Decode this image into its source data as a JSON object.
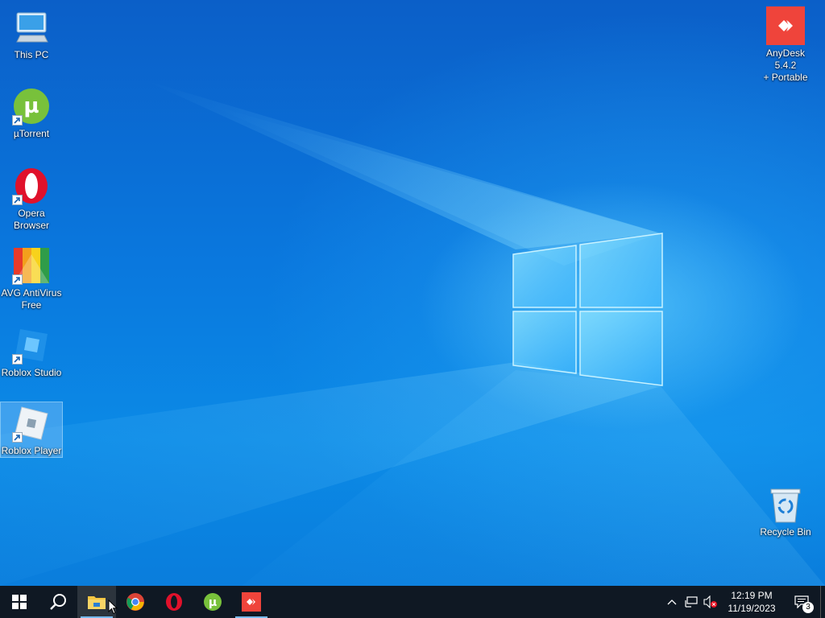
{
  "desktop": {
    "icons_left": [
      {
        "label": "This PC",
        "icon": "this-pc-icon",
        "shortcut": false,
        "selected": false
      },
      {
        "label": "µTorrent",
        "icon": "utorrent-icon",
        "shortcut": true,
        "selected": false
      },
      {
        "label": "Opera\nBrowser",
        "icon": "opera-icon",
        "shortcut": true,
        "selected": false
      },
      {
        "label": "AVG AntiVirus\nFree",
        "icon": "avg-icon",
        "shortcut": true,
        "selected": false
      },
      {
        "label": "Roblox Studio",
        "icon": "roblox-studio-icon",
        "shortcut": true,
        "selected": false
      },
      {
        "label": "Roblox Player",
        "icon": "roblox-player-icon",
        "shortcut": true,
        "selected": true
      }
    ],
    "anydesk": {
      "label": "AnyDesk 5.4.2\n+ Portable",
      "icon": "anydesk-icon"
    },
    "recycle_bin": {
      "label": "Recycle Bin",
      "icon": "recycle-bin-icon"
    }
  },
  "taskbar": {
    "pinned": [
      {
        "name": "start",
        "icon": "windows-start-icon"
      },
      {
        "name": "search",
        "icon": "search-icon"
      },
      {
        "name": "file-explorer",
        "icon": "file-explorer-icon",
        "active": true
      },
      {
        "name": "chrome",
        "icon": "chrome-icon"
      },
      {
        "name": "opera",
        "icon": "opera-icon"
      },
      {
        "name": "utorrent",
        "icon": "utorrent-icon"
      },
      {
        "name": "anydesk",
        "icon": "anydesk-icon",
        "running": true
      }
    ],
    "tray": {
      "time": "12:19 PM",
      "date": "11/19/2023",
      "notification_count": "3"
    }
  },
  "colors": {
    "taskbar": "#0f1823",
    "accent": "#76b9ed",
    "anydesk": "#ef443b",
    "opera": "#e0112b",
    "utorrent": "#78c13b"
  }
}
